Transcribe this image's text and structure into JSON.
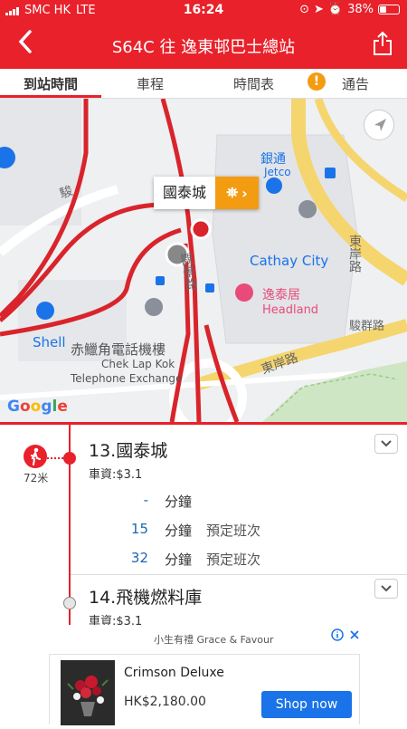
{
  "status_bar": {
    "carrier": "SMC HK",
    "network": "LTE",
    "time": "16:24",
    "battery": "38%",
    "battery_level": 0.38
  },
  "header": {
    "title": "S64C 往 逸東邨巴士總站"
  },
  "tabs": [
    {
      "label": "到站時間",
      "active": true
    },
    {
      "label": "車程",
      "active": false
    },
    {
      "label": "時間表",
      "active": false
    },
    {
      "label": "通告",
      "active": false
    }
  ],
  "notice_mark": "!",
  "map": {
    "labels": {
      "jetco_cn": "銀通",
      "jetco_en": "Jetco",
      "cathay_city": "Cathay City",
      "headland_cn": "逸泰居",
      "headland_en": "Headland",
      "shell": "Shell",
      "telecom_cn": "赤鱲角電話機樓",
      "telecom_en1": "Chek Lap Kok",
      "telecom_en2": "Telephone Exchange",
      "road1": "東岸路",
      "road2": "駿群路",
      "road3": "東岸路",
      "road4": "觀景路",
      "road5": "駿",
      "google": "Google"
    },
    "bubble_name": "國泰城"
  },
  "stops": [
    {
      "name": "13.國泰城",
      "fare": "車資:$3.1",
      "walk_distance": "72米",
      "etas": [
        {
          "minutes": "-",
          "unit": "分鐘",
          "remark": ""
        },
        {
          "minutes": "15",
          "unit": "分鐘",
          "remark": "預定班次"
        },
        {
          "minutes": "32",
          "unit": "分鐘",
          "remark": "預定班次"
        }
      ]
    },
    {
      "name": "14.飛機燃料庫",
      "fare": "車資:$3.1"
    }
  ],
  "ad": {
    "sponsor": "小生有禮 Grace & Favour",
    "title": "Crimson Deluxe",
    "price": "HK$2,180.00",
    "button": "Shop now"
  },
  "colors": {
    "brand_red": "#e8212b",
    "accent_orange": "#f39c12",
    "eta_blue": "#1e66b4",
    "ad_blue": "#1a73e8"
  }
}
